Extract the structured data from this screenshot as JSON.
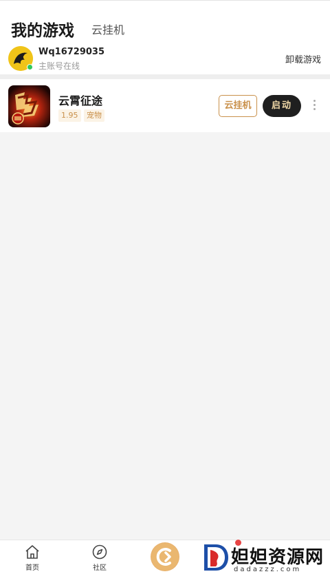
{
  "header": {
    "title": "我的游戏",
    "cloud_tab": "云挂机"
  },
  "account": {
    "username": "Wq16729035",
    "status": "主账号在线",
    "uninstall_label": "卸载游戏",
    "online_color": "#31c85a"
  },
  "games": [
    {
      "name": "云霄征途",
      "version": "1.95",
      "tag": "宠物",
      "icon": "game-icon",
      "cloud_label": "云挂机",
      "launch_label": "启动"
    }
  ],
  "bottom_nav": {
    "home": {
      "label": "首页",
      "icon": "home-icon"
    },
    "community": {
      "label": "社区",
      "icon": "compass-icon"
    },
    "center_icon": "cloud-logo-icon"
  },
  "watermark": {
    "title": "妲妲资源网",
    "domain": "dadazzz.com"
  },
  "colors": {
    "accent": "#c9904a",
    "launch_bg": "#1f1f1f",
    "launch_text": "#f1d9a8"
  }
}
